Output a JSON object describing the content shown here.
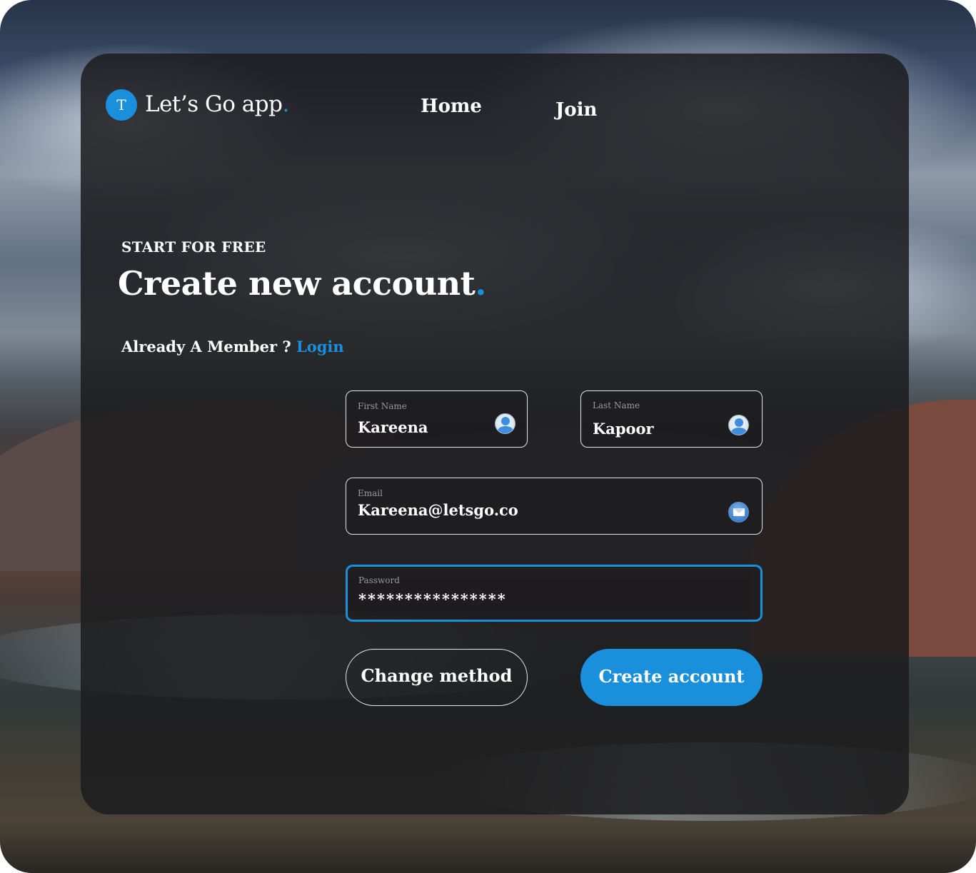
{
  "brand": {
    "badge_letter": "T",
    "name": "Let’s Go app",
    "dot": ".",
    "accent_color": "#1a8fdc"
  },
  "nav": {
    "home": "Home",
    "join": "Join"
  },
  "hero": {
    "eyebrow": "START FOR FREE",
    "title": "Create new account",
    "title_dot": ".",
    "member_prompt": "Already A Member ? ",
    "login_link": "Login"
  },
  "form": {
    "first_name": {
      "label": "First Name",
      "value": "Kareena",
      "icon": "user-icon"
    },
    "last_name": {
      "label": "Last Name",
      "value": "Kapoor",
      "icon": "user-icon"
    },
    "email": {
      "label": "Email",
      "value": "Kareena@letsgo.co",
      "icon": "mail-icon"
    },
    "password": {
      "label": "Password",
      "value": "****************",
      "focused": true
    }
  },
  "actions": {
    "change_method": "Change method",
    "create_account": "Create account"
  }
}
